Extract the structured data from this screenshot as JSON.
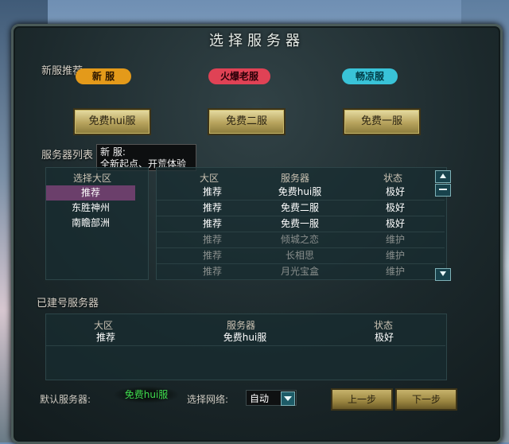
{
  "dialog": {
    "title": "选择服务器"
  },
  "recommend": {
    "label": "新服推荐",
    "tabs": [
      {
        "label": "新 服",
        "color": "#e49a1a"
      },
      {
        "label": "火爆老服",
        "color": "#e04255"
      },
      {
        "label": "畅凉服",
        "color": "#39c3d8"
      }
    ],
    "buttons": [
      "免费hui服",
      "免费二服",
      "免费一服"
    ]
  },
  "tooltip": {
    "line1": "新 服:",
    "line2": "全新起点、开荒体验"
  },
  "server_list": {
    "label": "服务器列表",
    "region_header": "选择大区",
    "regions": [
      {
        "name": "推荐",
        "selected": true
      },
      {
        "name": "东胜神州",
        "selected": false
      },
      {
        "name": "南瞻部洲",
        "selected": false
      }
    ],
    "headers": [
      "大区",
      "服务器",
      "状态"
    ],
    "rows": [
      {
        "region": "推荐",
        "server": "免费hui服",
        "status": "极好"
      },
      {
        "region": "推荐",
        "server": "免费二服",
        "status": "极好"
      },
      {
        "region": "推荐",
        "server": "免费一服",
        "status": "极好"
      },
      {
        "region": "推荐",
        "server": "倾城之恋",
        "status": "维护"
      },
      {
        "region": "推荐",
        "server": "长相思",
        "status": "维护"
      },
      {
        "region": "推荐",
        "server": "月光宝盒",
        "status": "维护"
      }
    ]
  },
  "built_servers": {
    "label": "已建号服务器",
    "headers": [
      "大区",
      "服务器",
      "状态"
    ],
    "rows": [
      {
        "region": "推荐",
        "server": "免费hui服",
        "status": "极好"
      }
    ]
  },
  "bottom": {
    "default_label": "默认服务器:",
    "default_value": "免费hui服",
    "network_label": "选择网络:",
    "network_value": "自动",
    "prev_label": "上一步",
    "next_label": "下一步"
  }
}
